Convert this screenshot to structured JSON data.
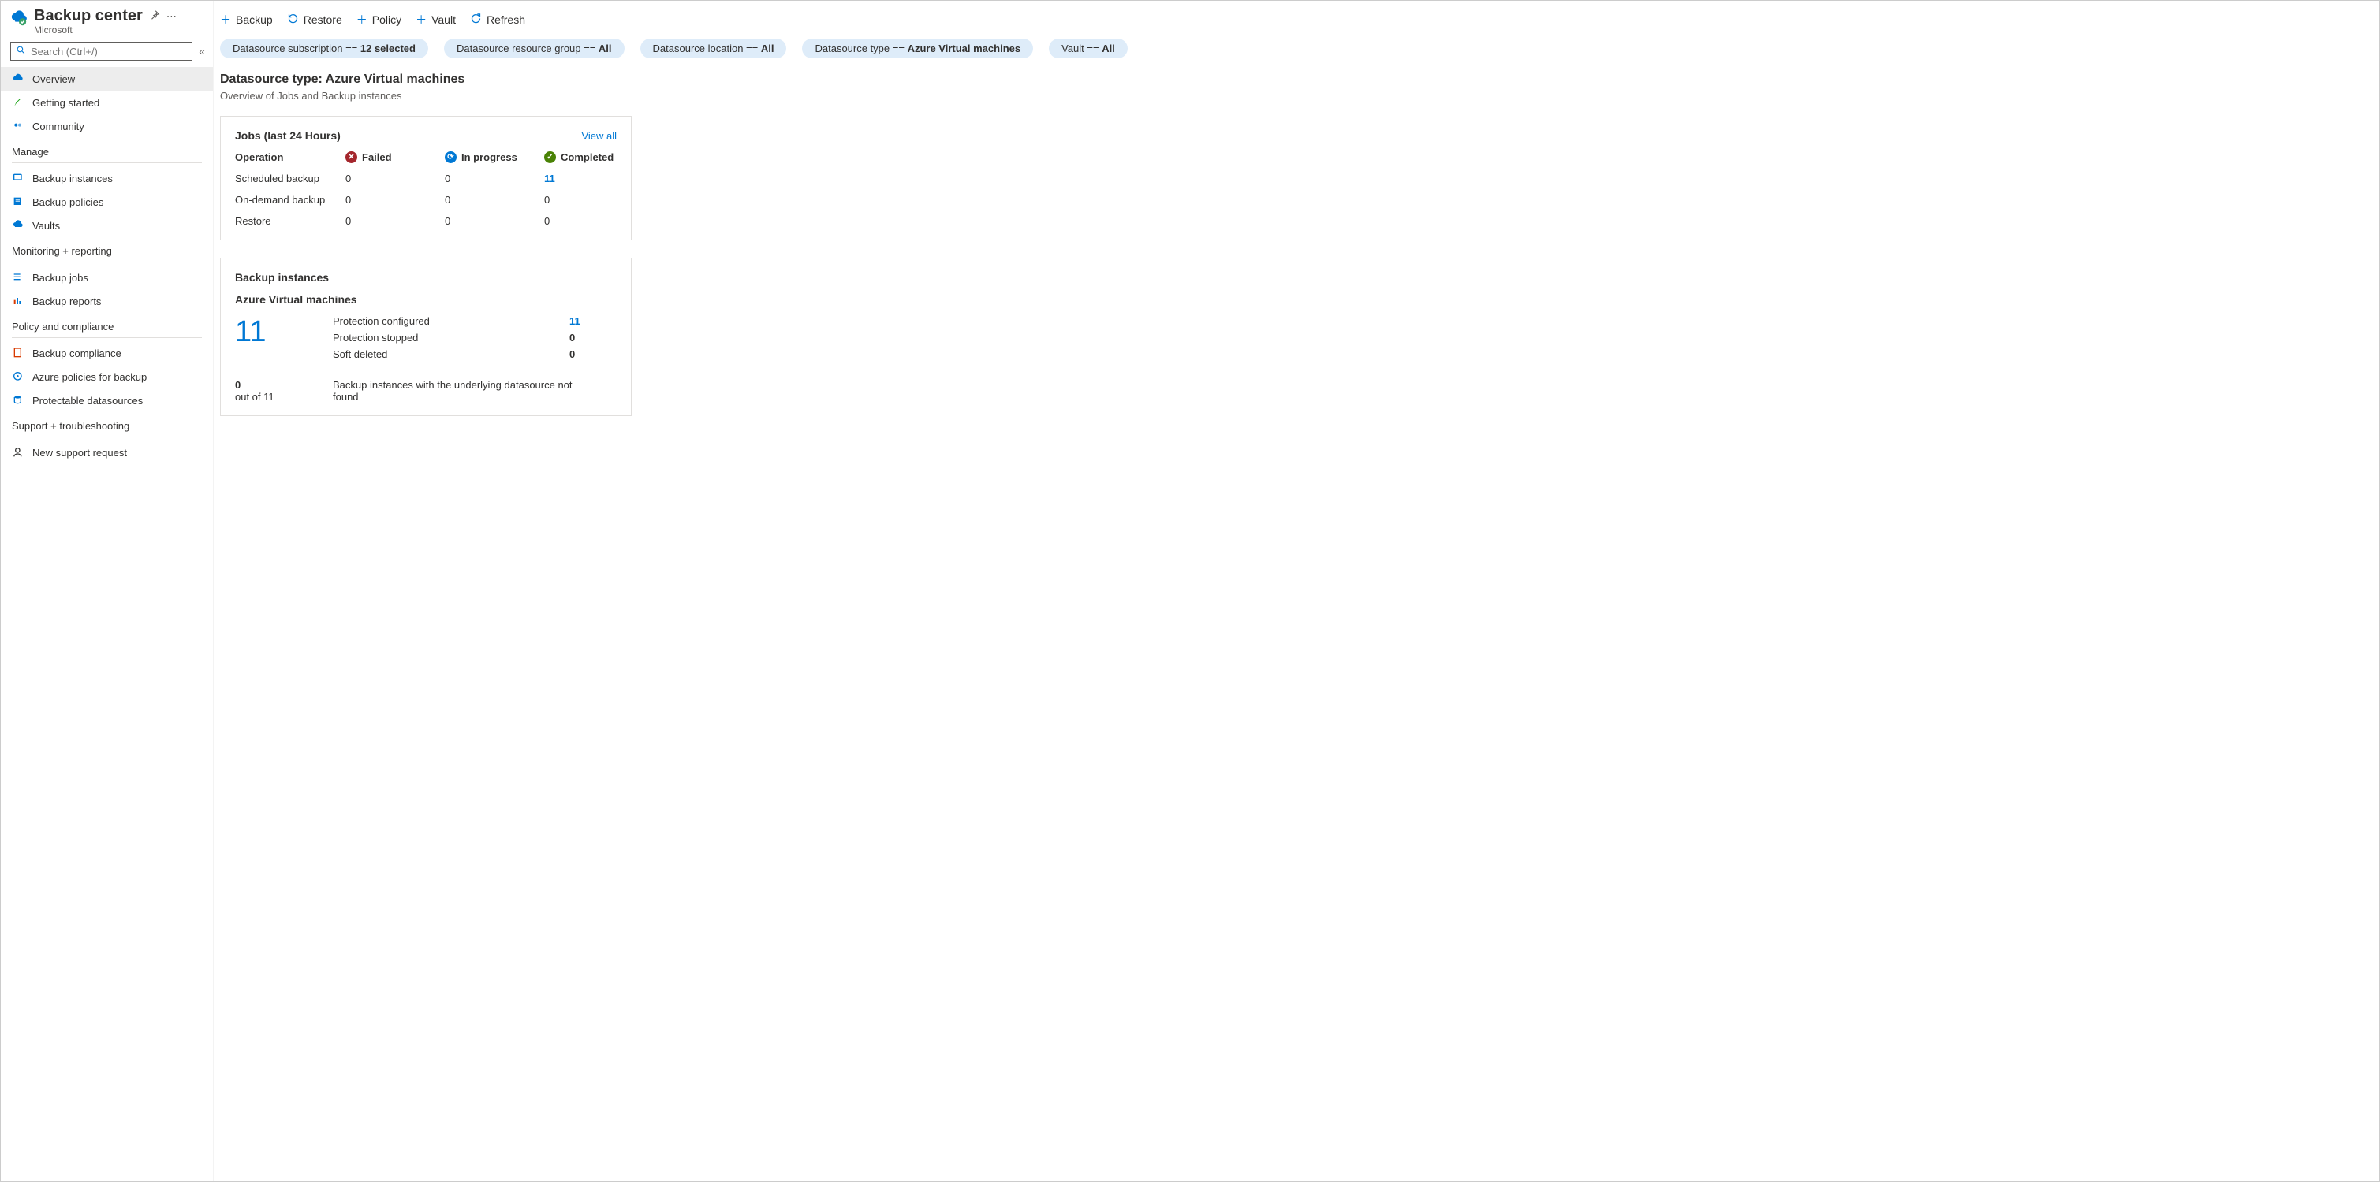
{
  "header": {
    "title": "Backup center",
    "subtitle": "Microsoft"
  },
  "search": {
    "placeholder": "Search (Ctrl+/)"
  },
  "nav": {
    "top": [
      {
        "label": "Overview",
        "active": true
      },
      {
        "label": "Getting started"
      },
      {
        "label": "Community"
      }
    ],
    "groups": [
      {
        "title": "Manage",
        "items": [
          {
            "label": "Backup instances"
          },
          {
            "label": "Backup policies"
          },
          {
            "label": "Vaults"
          }
        ]
      },
      {
        "title": "Monitoring + reporting",
        "items": [
          {
            "label": "Backup jobs"
          },
          {
            "label": "Backup reports"
          }
        ]
      },
      {
        "title": "Policy and compliance",
        "items": [
          {
            "label": "Backup compliance"
          },
          {
            "label": "Azure policies for backup"
          },
          {
            "label": "Protectable datasources"
          }
        ]
      },
      {
        "title": "Support + troubleshooting",
        "items": [
          {
            "label": "New support request"
          }
        ]
      }
    ]
  },
  "toolbar": {
    "backup": "Backup",
    "restore": "Restore",
    "policy": "Policy",
    "vault": "Vault",
    "refresh": "Refresh"
  },
  "filters": {
    "f0_label": "Datasource subscription == ",
    "f0_value": "12 selected",
    "f1_label": "Datasource resource group == ",
    "f1_value": "All",
    "f2_label": "Datasource location == ",
    "f2_value": "All",
    "f3_label": "Datasource type == ",
    "f3_value": "Azure Virtual machines",
    "f4_label": "Vault == ",
    "f4_value": "All"
  },
  "page": {
    "title": "Datasource type: Azure Virtual machines",
    "subtitle": "Overview of Jobs and Backup instances"
  },
  "jobs": {
    "title": "Jobs (last 24 Hours)",
    "viewall": "View all",
    "head_op": "Operation",
    "head_failed": "Failed",
    "head_inprog": "In progress",
    "head_done": "Completed",
    "r0": {
      "label": "Scheduled backup",
      "failed": "0",
      "inprog": "0",
      "done": "11"
    },
    "r1": {
      "label": "On-demand backup",
      "failed": "0",
      "inprog": "0",
      "done": "0"
    },
    "r2": {
      "label": "Restore",
      "failed": "0",
      "inprog": "0",
      "done": "0"
    }
  },
  "bi": {
    "title": "Backup instances",
    "sub": "Azure Virtual machines",
    "total": "11",
    "rows": {
      "r0l": "Protection configured",
      "r0v": "11",
      "r1l": "Protection stopped",
      "r1v": "0",
      "r2l": "Soft deleted",
      "r2v": "0"
    },
    "footer_count": "0",
    "footer_outof": "out of 11",
    "footer_msg": "Backup instances with the underlying datasource not found"
  }
}
